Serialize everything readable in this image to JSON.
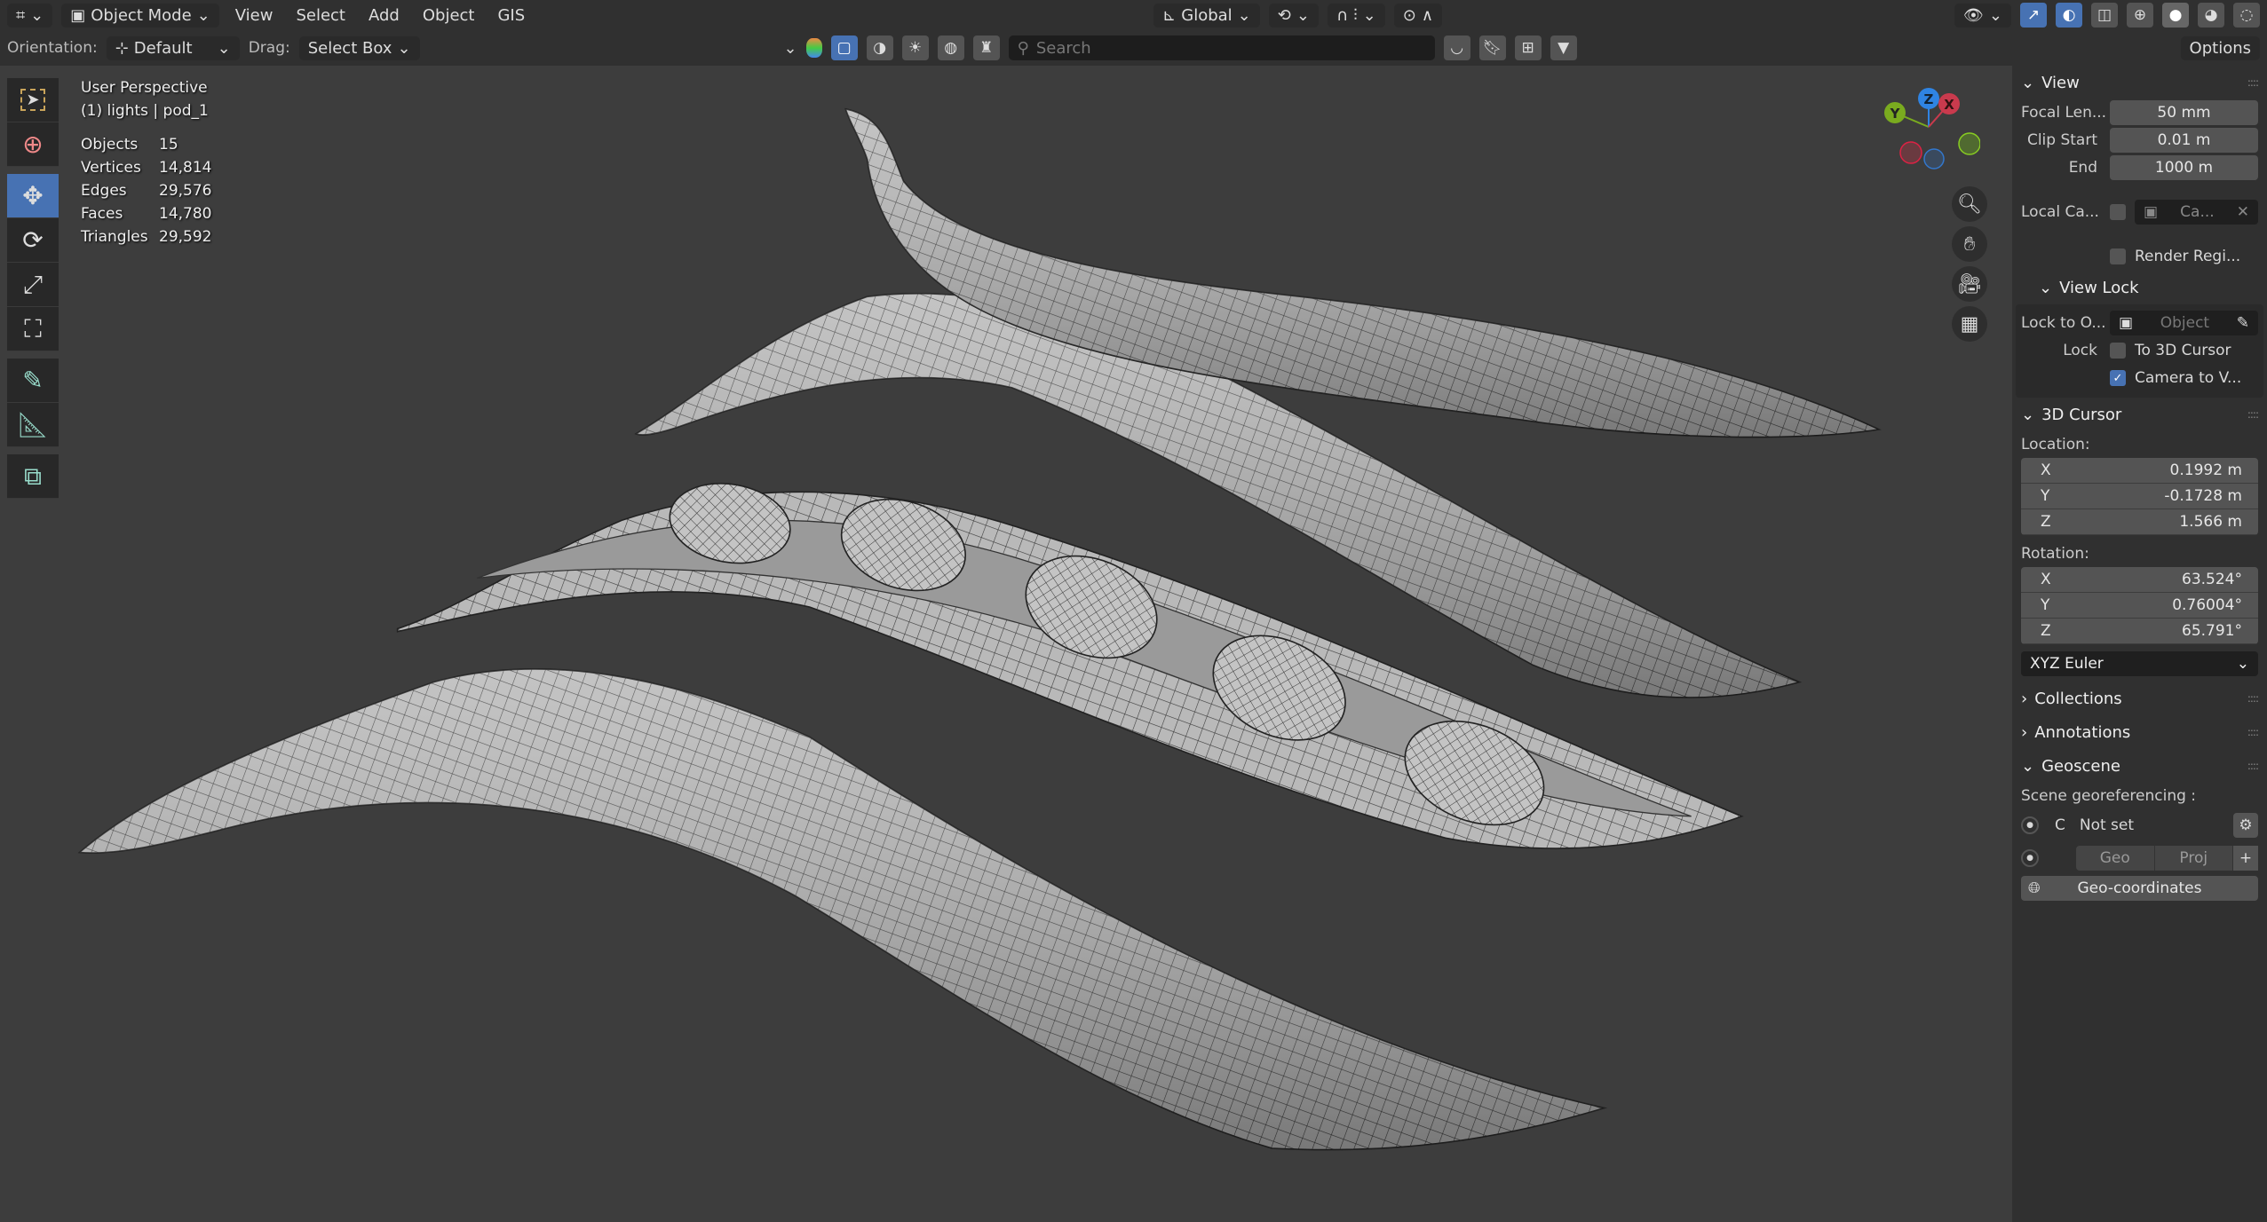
{
  "header": {
    "mode": "Object Mode",
    "menus": [
      "View",
      "Select",
      "Add",
      "Object",
      "GIS"
    ],
    "transform_orientation": "Global",
    "orientation_label": "Orientation:",
    "orientation_value": "Default",
    "drag_label": "Drag:",
    "drag_value": "Select Box",
    "search_placeholder": "Search",
    "options": "Options"
  },
  "overlay": {
    "view_name": "User Perspective",
    "context": "(1) lights | pod_1",
    "stats": [
      {
        "label": "Objects",
        "value": "15"
      },
      {
        "label": "Vertices",
        "value": "14,814"
      },
      {
        "label": "Edges",
        "value": "29,576"
      },
      {
        "label": "Faces",
        "value": "14,780"
      },
      {
        "label": "Triangles",
        "value": "29,592"
      }
    ]
  },
  "gizmo": {
    "x": "X",
    "y": "Y",
    "z": "Z",
    "colors": {
      "x": "#c93a4d",
      "y": "#7aab1f",
      "z": "#2f84e3"
    }
  },
  "panel": {
    "view": {
      "title": "View",
      "focal_label": "Focal Len...",
      "focal": "50 mm",
      "clip_start_label": "Clip Start",
      "clip_start": "0.01 m",
      "end_label": "End",
      "end": "1000 m",
      "local_cam_label": "Local Ca...",
      "local_cam_value": "Ca...",
      "render_region": "Render Regi..."
    },
    "view_lock": {
      "title": "View Lock",
      "lock_to_label": "Lock to O...",
      "lock_to_placeholder": "Object",
      "lock_label": "Lock",
      "to_cursor": "To 3D Cursor",
      "camera_to_view": "Camera to V...",
      "camera_to_view_checked": true,
      "to_cursor_checked": false
    },
    "cursor": {
      "title": "3D Cursor",
      "location_label": "Location:",
      "location": [
        {
          "axis": "X",
          "value": "0.1992 m"
        },
        {
          "axis": "Y",
          "value": "-0.1728 m"
        },
        {
          "axis": "Z",
          "value": "1.566 m"
        }
      ],
      "rotation_label": "Rotation:",
      "rotation": [
        {
          "axis": "X",
          "value": "63.524°"
        },
        {
          "axis": "Y",
          "value": "0.76004°"
        },
        {
          "axis": "Z",
          "value": "65.791°"
        }
      ],
      "rotation_mode": "XYZ Euler"
    },
    "collections": "Collections",
    "annotations": "Annotations",
    "geoscene": {
      "title": "Geoscene",
      "georef_label": "Scene georeferencing :",
      "crs_code": "C",
      "crs_value": "Not set",
      "geo": "Geo",
      "proj": "Proj",
      "geo_coords": "Geo-coordinates"
    }
  },
  "accent": "#4772b3"
}
